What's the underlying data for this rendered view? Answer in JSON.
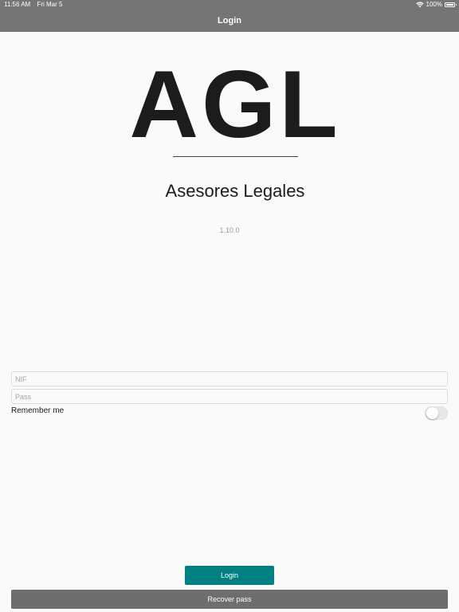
{
  "status_bar": {
    "time": "11:56 AM",
    "date": "Fri Mar 5",
    "battery": "100%",
    "wifi_icon": "wifi-icon",
    "battery_icon": "battery-icon"
  },
  "nav": {
    "title": "Login"
  },
  "branding": {
    "logo_text": "AGL",
    "company_name": "Asesores Legales",
    "version": "1.10.0"
  },
  "form": {
    "nif": {
      "placeholder": "NIF",
      "value": ""
    },
    "pass": {
      "placeholder": "Pass",
      "value": ""
    },
    "remember_label": "Remember me",
    "remember_on": false
  },
  "buttons": {
    "login_label": "Login",
    "recover_label": "Recover pass"
  },
  "colors": {
    "header_bg": "#757575",
    "login_button_bg": "#008080",
    "recover_button_bg": "#6e6e6e"
  }
}
